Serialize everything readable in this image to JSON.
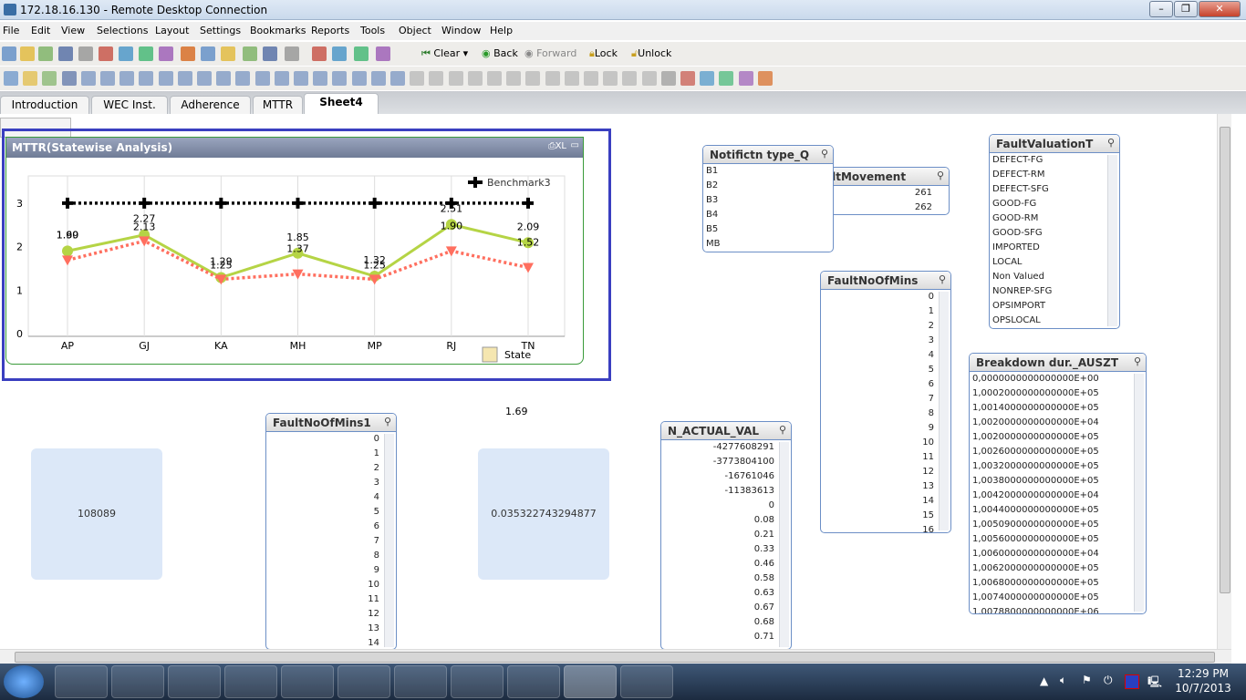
{
  "window": {
    "title": "172.18.16.130 - Remote Desktop Connection",
    "minimize": "–",
    "restore": "❐",
    "close": "✕"
  },
  "menu": [
    "File",
    "Edit",
    "View",
    "Selections",
    "Layout",
    "Settings",
    "Bookmarks",
    "Reports",
    "Tools",
    "Object",
    "Window",
    "Help"
  ],
  "toolbar": {
    "clear": "Clear",
    "back": "Back",
    "forward": "Forward",
    "lock": "Lock",
    "unlock": "Unlock"
  },
  "tabs": [
    {
      "label": "Introduction"
    },
    {
      "label": "WEC Inst."
    },
    {
      "label": "Adherence"
    },
    {
      "label": "MTTR"
    },
    {
      "label": "Sheet4",
      "active": true
    }
  ],
  "chart": {
    "title": "MTTR(Statewise Analysis)",
    "xl": "XL",
    "dimension_label": "State"
  },
  "chart_data": {
    "type": "line",
    "categories": [
      "AP",
      "GJ",
      "KA",
      "MH",
      "MP",
      "RJ",
      "TN"
    ],
    "ylim": [
      0,
      3
    ],
    "yticks": [
      0,
      1,
      2,
      3
    ],
    "grid": "vertical",
    "legend": "top-right",
    "xlabel": "State",
    "series": [
      {
        "values": [
          1.9,
          2.27,
          1.29,
          1.85,
          1.32,
          2.51,
          2.09
        ],
        "color": "#b5d445",
        "style": "solid",
        "marker": "circle"
      },
      {
        "values": [
          1.69,
          2.13,
          1.25,
          1.37,
          1.25,
          1.9,
          1.52
        ],
        "color": "#ff6f5f",
        "style": "dotted",
        "marker": "triangle-down"
      },
      {
        "name": "Benchmark3",
        "values": [
          3,
          3,
          3,
          3,
          3,
          3,
          3
        ],
        "color": "#000000",
        "style": "dotted",
        "marker": "plus"
      }
    ]
  },
  "kpis": {
    "left": "108089",
    "middle_label": "1.69",
    "middle": "0.035322743294877"
  },
  "listboxes": {
    "notif": {
      "title": "Notifictn type_Q",
      "items": [
        "B1",
        "B2",
        "B3",
        "B4",
        "B5",
        "MB"
      ]
    },
    "faultmove": {
      "title": "FaultMovement",
      "items": [
        "261",
        "262"
      ]
    },
    "faultval": {
      "title": "FaultValuationT",
      "items": [
        "DEFECT-FG",
        "DEFECT-RM",
        "DEFECT-SFG",
        "GOOD-FG",
        "GOOD-RM",
        "GOOD-SFG",
        "IMPORTED",
        "LOCAL",
        "Non Valued",
        "NONREP-SFG",
        "OPSIMPORT",
        "OPSLOCAL"
      ]
    },
    "faultmins": {
      "title": "FaultNoOfMins",
      "items": [
        "0",
        "1",
        "2",
        "3",
        "4",
        "5",
        "6",
        "7",
        "8",
        "9",
        "10",
        "11",
        "12",
        "13",
        "14",
        "15",
        "16"
      ]
    },
    "breakdown": {
      "title": "Breakdown dur._AUSZT",
      "items": [
        "0,0000000000000000E+00",
        "1,0002000000000000E+05",
        "1,0014000000000000E+05",
        "1,0020000000000000E+04",
        "1,0020000000000000E+05",
        "1,0026000000000000E+05",
        "1,0032000000000000E+05",
        "1,0038000000000000E+05",
        "1,0042000000000000E+04",
        "1,0044000000000000E+05",
        "1,0050900000000000E+05",
        "1,0056000000000000E+05",
        "1,0060000000000000E+04",
        "1,0062000000000000E+05",
        "1,0068000000000000E+05",
        "1,0074000000000000E+05",
        "1,0078800000000000E+06"
      ]
    },
    "faultmins1": {
      "title": "FaultNoOfMins1",
      "items": [
        "0",
        "1",
        "2",
        "3",
        "4",
        "5",
        "6",
        "7",
        "8",
        "9",
        "10",
        "11",
        "12",
        "13",
        "14"
      ]
    },
    "nactual": {
      "title": "N_ACTUAL_VAL",
      "items": [
        "-4277608291",
        "-3773804100",
        "-16761046",
        "-11383613",
        "0",
        "0.08",
        "0.21",
        "0.33",
        "0.46",
        "0.58",
        "0.63",
        "0.67",
        "0.68",
        "0.71"
      ]
    }
  },
  "tray": {
    "time": "12:29 PM",
    "date": "10/7/2013"
  },
  "colors": {
    "selection": "#3a3fc0",
    "accent_green": "#b5d445",
    "accent_red": "#ff6f5f"
  }
}
